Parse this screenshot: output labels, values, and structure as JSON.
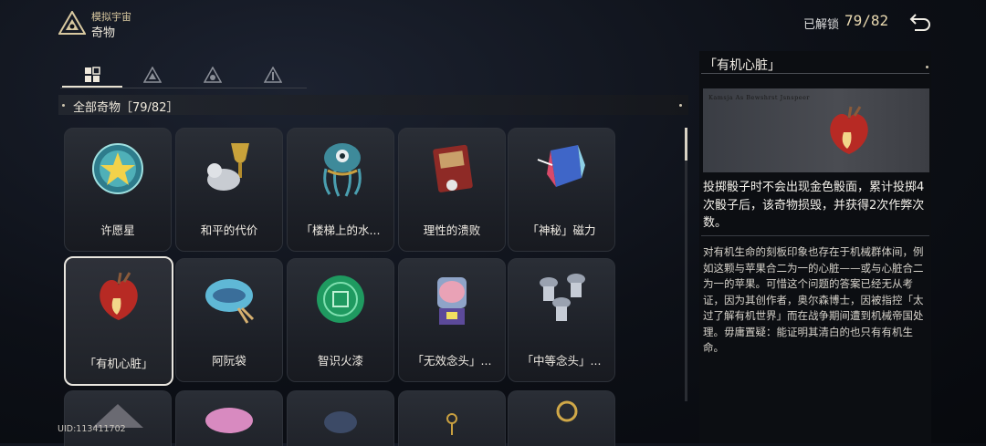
{
  "header": {
    "module": "模拟宇宙",
    "title": "奇物",
    "unlock_label": "已解锁",
    "unlock_count": "79/82"
  },
  "tabs": [
    {
      "icon": "grid-icon",
      "active": true
    },
    {
      "icon": "path-emblem-icon",
      "active": false
    },
    {
      "icon": "path-emblem-icon",
      "active": false
    },
    {
      "icon": "path-emblem-icon",
      "active": false
    }
  ],
  "category": {
    "label": "全部奇物［79/82］"
  },
  "items": [
    {
      "name": "许愿星"
    },
    {
      "name": "和平的代价"
    },
    {
      "name": "「楼梯上的水..."
    },
    {
      "name": "理性的溃败"
    },
    {
      "name": "「神秘」磁力"
    },
    {
      "name": "「有机心脏」",
      "selected": true
    },
    {
      "name": "阿阮袋"
    },
    {
      "name": "智识火漆"
    },
    {
      "name": "「无效念头」..."
    },
    {
      "name": "「中等念头」..."
    }
  ],
  "uid": "UID:113411702",
  "detail": {
    "title": "「有机心脏」",
    "preview_caption": "Kamsja As Bewshrst Jsnspeer",
    "effect": "投掷骰子时不会出现金色骰面，累计投掷4次骰子后，该奇物损毁，并获得2次作弊次数。",
    "lore": "对有机生命的刻板印象也存在于机械群体间，例如这颗与苹果合二为一的心脏——或与心脏合二为一的苹果。可惜这个问题的答案已经无从考证，因为其创作者，奥尔森博士，因被指控「太过了解有机世界」而在战争期间遭到机械帝国处理。毋庸置疑：能证明其清白的也只有有机生命。"
  },
  "colors": {
    "accent": "#e8d8b0",
    "selected_border": "#e9e6df",
    "background": "#0d1017"
  }
}
